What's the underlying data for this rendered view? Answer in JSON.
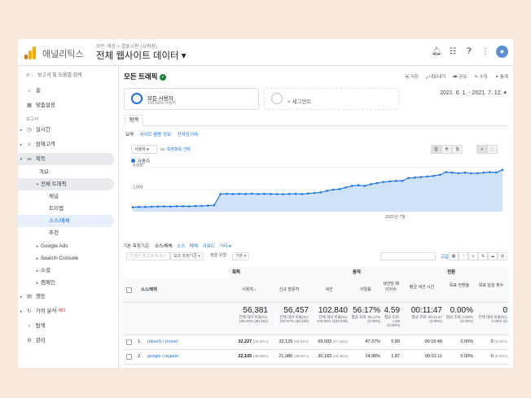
{
  "app": {
    "name": "애널리틱스",
    "breadcrumb": "모든 계정 > 결표시판 (샤짝점)",
    "property": "전체 웹사이트 데이터 ▾",
    "brand_colors": [
      "#f9ab00",
      "#e37400"
    ],
    "top_icons": [
      "bell-icon",
      "apps-grid-icon",
      "help-icon",
      "more-vert-icon"
    ],
    "avatar_initial": "●"
  },
  "sidebar": {
    "search": "보고서 및 도움말 검색",
    "home": "홈",
    "customization": "맞춤설정",
    "section_reports": "보고서",
    "realtime": "실시간",
    "audience": "잠재고객",
    "acquisition": "획득",
    "overview": "개요",
    "all_traffic": "전체 트래픽",
    "channels": "채널",
    "treemaps": "트리맵",
    "source_medium": "소스/매체",
    "referrals": "추천",
    "google_ads": "Google Ads",
    "search_console": "Search Console",
    "social": "소셜",
    "campaigns": "캠페인",
    "behavior": "행동",
    "attribution": "기여 분석",
    "attribution_badge": "베타",
    "discover": "탐색",
    "admin": "관리"
  },
  "report": {
    "title": "모든 트래픽",
    "actions": [
      "저장",
      "내보내기",
      "공유",
      "수정",
      "통계"
    ],
    "segment_all": "모든 사용자",
    "segment_all_sub": "100.00% 사용자",
    "segment_add": "+ 세그먼트",
    "date_range": "2021. 6. 1. - 2021. 7. 12. ▾",
    "tab": "탐색",
    "subnav": [
      "요약",
      "사이트 활용 정보",
      "전자상거래"
    ],
    "metric_dropdown": "사용자 ▾",
    "vs_label": "vs.",
    "vs_select": "측정항목 선택",
    "granularity": [
      "일",
      "주",
      "월"
    ],
    "legend": "사용자",
    "primary_dim_label": "기본 측정기준:",
    "dims": [
      "소스/매체",
      "소스",
      "매체",
      "키워드",
      "기타 ▾"
    ],
    "plot_rows_btn": "선택한 열 도표에 표시",
    "secondary_dim_btn": "보조 측정기준 ▾",
    "sort_type_label": "정렬 유형:",
    "sort_type_value": "기본 ▾",
    "advanced": "고급"
  },
  "table": {
    "groups": [
      "획득",
      "동작",
      "전환"
    ],
    "headers": [
      "소스/매체",
      "사용자",
      "신규 방문자",
      "세션",
      "이탈률",
      "세션당 페이지수",
      "평균 세션 시간",
      "목표 전환율",
      "목표 달성 횟수"
    ],
    "totals": [
      {
        "v": "56,381",
        "s": "전체 대비 비율(%): 100.00% (56,381)"
      },
      {
        "v": "56,457",
        "s": "전체 대비 비율(%): 100.07% (56,418)"
      },
      {
        "v": "102,840",
        "s": "전체 대비 비율(%): 100.00% (102,840)"
      },
      {
        "v": "56.17%",
        "s": "평균 조회: 56.17% (0.00%)"
      },
      {
        "v": "4.59",
        "s": "평균 조회: 4.59 (0.00%)"
      },
      {
        "v": "00:11:47",
        "s": "평균 조회: 00:11:47 (0.00%)"
      },
      {
        "v": "0.00%",
        "s": "평균 조회: 0.00% (0.00%)"
      },
      {
        "v": "0",
        "s": "전체 대비 비율(%): 0.00% (0)"
      }
    ],
    "rows": [
      {
        "num": "1.",
        "name": "(direct) / (none)",
        "users": "32,227",
        "users_pct": "(56.85%)",
        "new": "32,129",
        "new_pct": "(56.91%)",
        "sessions": "69,093",
        "sessions_pct": "(67.18%)",
        "bounce": "47.37%",
        "pps": "5.89",
        "dur": "00:16:49",
        "conv": "0.00%",
        "goals": "0",
        "goals_pct": "(0.00%)"
      },
      {
        "num": "2.",
        "name": "google / organic",
        "users": "22,105",
        "users_pct": "(38.99%)",
        "new": "21,986",
        "new_pct": "(38.94%)",
        "sessions": "30,183",
        "sessions_pct": "(29.35%)",
        "bounce": "74.98%",
        "pps": "1.87",
        "dur": "00:01:11",
        "conv": "0.00%",
        "goals": "0",
        "goals_pct": "(0.00%)"
      }
    ]
  },
  "chart_data": {
    "type": "area",
    "title": "",
    "series": [
      {
        "name": "사용자",
        "values": [
          400,
          420,
          430,
          450,
          470,
          480,
          470,
          490,
          500,
          480,
          510,
          520,
          550,
          580,
          1600,
          1620,
          1600,
          1620,
          1610,
          1640,
          1600,
          1620,
          1610,
          1600,
          1590,
          1610,
          1620,
          1600,
          1650,
          1700,
          1750,
          1900,
          2000,
          2050,
          2200,
          2350,
          2400,
          2350,
          2500,
          2600,
          2700,
          2750,
          2800,
          2800,
          3050,
          3100,
          3150,
          3200,
          3250,
          3350,
          3600,
          3550,
          3500,
          3550,
          3480,
          3500,
          3550,
          3600,
          3560,
          3800
        ]
      }
    ],
    "y_ticks": [
      "4,000",
      "2,000"
    ],
    "ylim": [
      0,
      4000
    ],
    "x_label": "2021년 7월",
    "line_color": "#1a73e8",
    "fill_color": "#cfe2f7"
  }
}
